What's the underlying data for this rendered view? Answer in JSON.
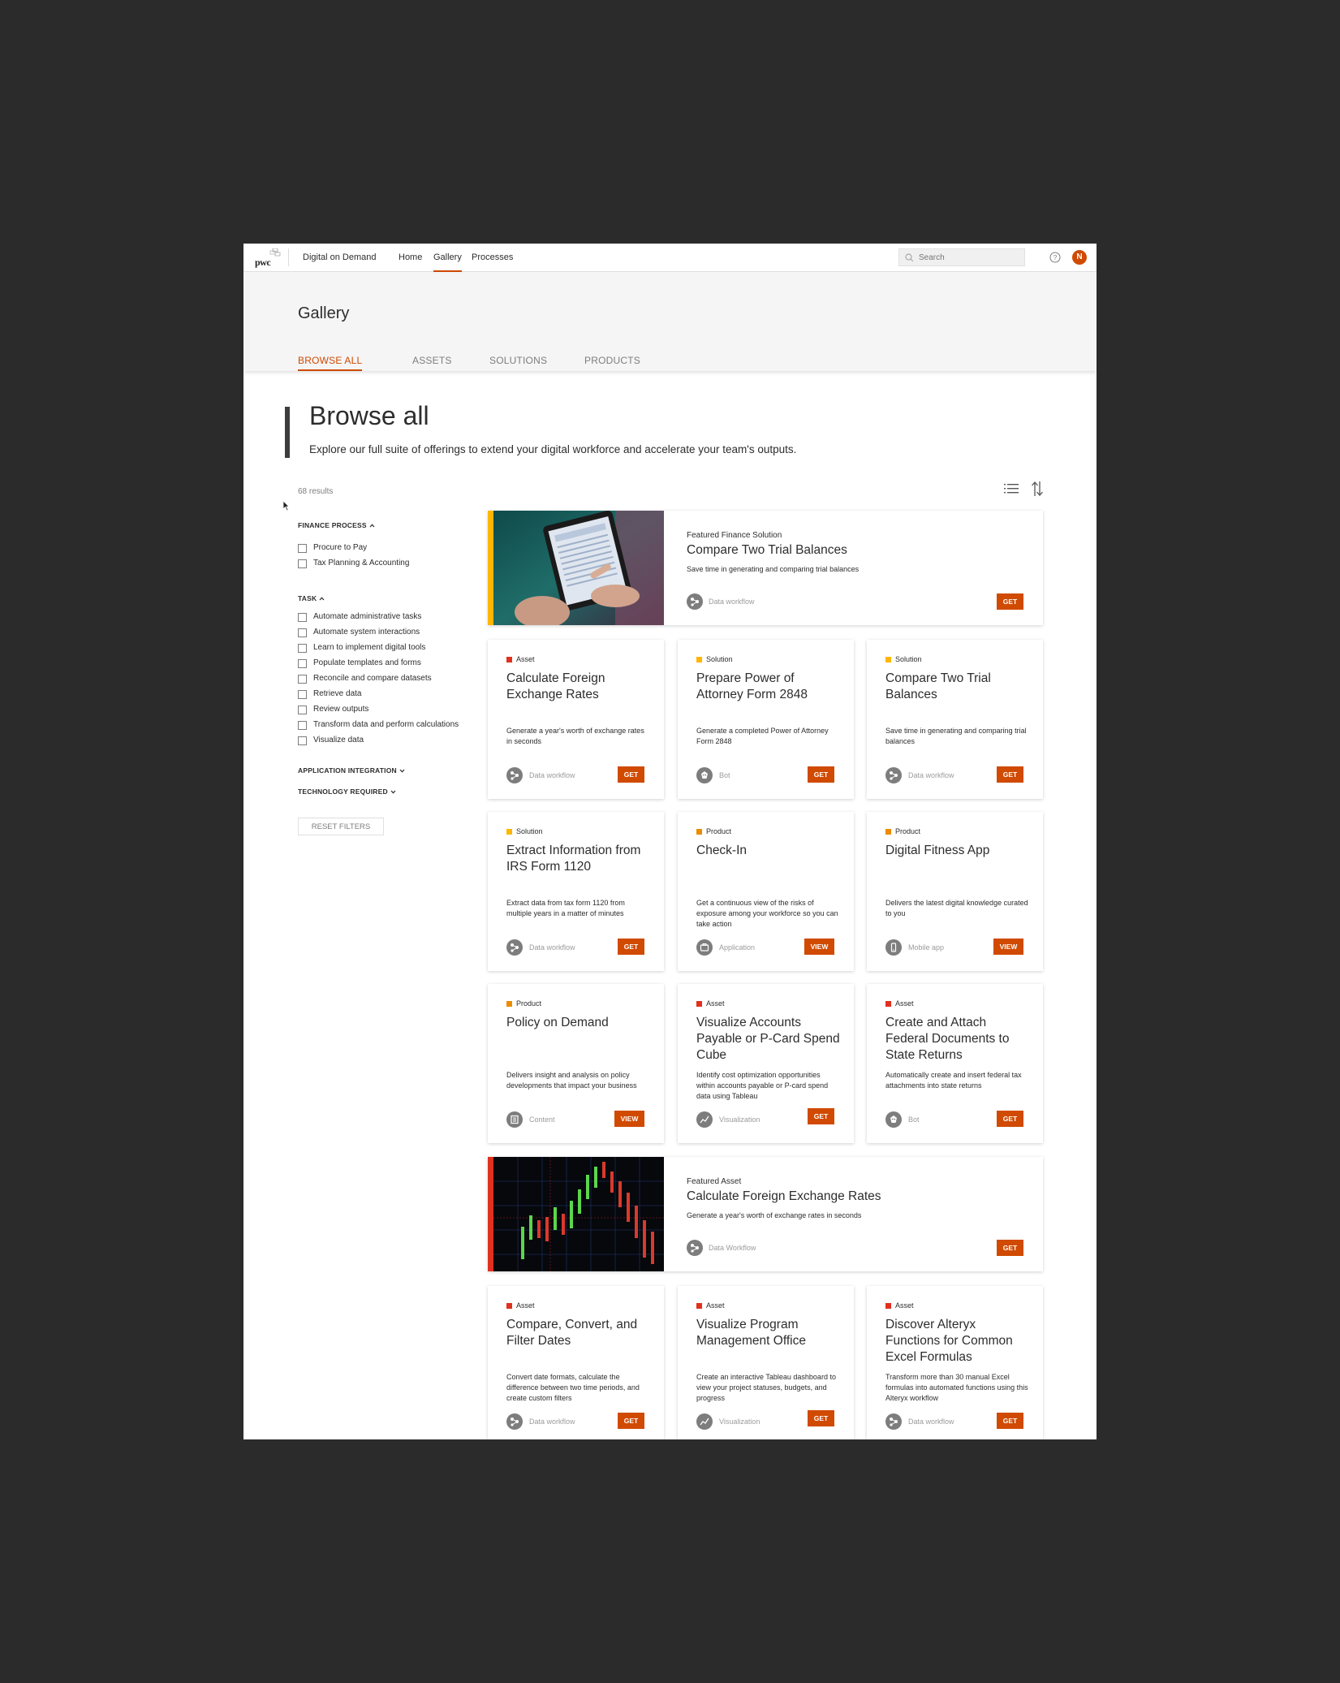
{
  "navbar": {
    "logo_text": "pwc",
    "app_name": "Digital on Demand",
    "links": [
      {
        "label": "Home",
        "active": false
      },
      {
        "label": "Gallery",
        "active": true
      },
      {
        "label": "Processes",
        "active": false
      }
    ],
    "search_placeholder": "Search",
    "avatar_initial": "N"
  },
  "subheader": {
    "title": "Gallery",
    "tabs": [
      {
        "label": "BROWSE ALL",
        "active": true
      },
      {
        "label": "ASSETS",
        "active": false
      },
      {
        "label": "SOLUTIONS",
        "active": false
      },
      {
        "label": "PRODUCTS",
        "active": false
      }
    ]
  },
  "browse": {
    "title": "Browse all",
    "description": "Explore our full suite of offerings to extend your digital workforce and accelerate your team's outputs.",
    "results": "68 results"
  },
  "filters": {
    "finance_process": {
      "heading": "FINANCE PROCESS",
      "expanded": true,
      "options": [
        "Procure to Pay",
        "Tax Planning & Accounting"
      ]
    },
    "task": {
      "heading": "TASK",
      "expanded": true,
      "options": [
        "Automate administrative tasks",
        "Automate system interactions",
        "Learn to implement digital tools",
        "Populate templates and forms",
        "Reconcile and compare datasets",
        "Retrieve data",
        "Review outputs",
        "Transform data and perform calculations",
        "Visualize data"
      ]
    },
    "application_integration": {
      "heading": "APPLICATION INTEGRATION",
      "expanded": false
    },
    "technology_required": {
      "heading": "TECHNOLOGY REQUIRED",
      "expanded": false
    },
    "reset_label": "RESET FILTERS"
  },
  "colors": {
    "accent": "#d04a02",
    "asset": "#e0301e",
    "solution": "#ffb600",
    "product": "#eb8c00"
  },
  "featured": [
    {
      "kicker": "Featured Finance Solution",
      "title": "Compare Two Trial Balances",
      "description": "Save time in generating and comparing trial balances",
      "meta": "Data workflow",
      "meta_icon": "data-workflow-icon",
      "action": "GET",
      "accent": "#ffb600",
      "image": "tablet-hands-image"
    },
    {
      "kicker": "Featured Asset",
      "title": "Calculate Foreign Exchange Rates",
      "description": "Generate a year's worth of exchange rates in seconds",
      "meta": "Data Workflow",
      "meta_icon": "data-workflow-icon",
      "action": "GET",
      "accent": "#e0301e",
      "image": "candlestick-chart-image"
    }
  ],
  "cards": [
    {
      "type": "Asset",
      "color": "#e0301e",
      "title": "Calculate Foreign Exchange Rates",
      "description": "Generate a year's worth of exchange rates in seconds",
      "meta": "Data workflow",
      "meta_icon": "data-workflow-icon",
      "action": "GET"
    },
    {
      "type": "Solution",
      "color": "#ffb600",
      "title": "Prepare Power of Attorney Form 2848",
      "description": "Generate a completed Power of Attorney Form 2848",
      "meta": "Bot",
      "meta_icon": "bot-icon",
      "action": "GET"
    },
    {
      "type": "Solution",
      "color": "#ffb600",
      "title": "Compare Two Trial Balances",
      "description": "Save time in generating and comparing trial balances",
      "meta": "Data workflow",
      "meta_icon": "data-workflow-icon",
      "action": "GET"
    },
    {
      "type": "Solution",
      "color": "#ffb600",
      "title": "Extract Information from IRS Form 1120",
      "description": "Extract data from tax form 1120 from multiple years in a matter of minutes",
      "meta": "Data workflow",
      "meta_icon": "data-workflow-icon",
      "action": "GET"
    },
    {
      "type": "Product",
      "color": "#eb8c00",
      "title": "Check-In",
      "description": "Get a continuous view of the risks of exposure among your workforce so you can take action",
      "meta": "Application",
      "meta_icon": "application-icon",
      "action": "VIEW"
    },
    {
      "type": "Product",
      "color": "#eb8c00",
      "title": "Digital Fitness App",
      "description": "Delivers the latest digital knowledge curated to you",
      "meta": "Mobile app",
      "meta_icon": "mobile-app-icon",
      "action": "VIEW"
    },
    {
      "type": "Product",
      "color": "#eb8c00",
      "title": "Policy on Demand",
      "description": "Delivers insight and analysis on policy developments that impact your business",
      "meta": "Content",
      "meta_icon": "content-icon",
      "action": "VIEW"
    },
    {
      "type": "Asset",
      "color": "#e0301e",
      "title": "Visualize Accounts Payable or P-Card Spend Cube",
      "description": "Identify cost optimization opportunities within accounts payable or P-card spend data using Tableau",
      "meta": "Visualization",
      "meta_icon": "visualization-icon",
      "action": "GET"
    },
    {
      "type": "Asset",
      "color": "#e0301e",
      "title": "Create and Attach Federal Documents to State Returns",
      "description": "Automatically create and insert federal tax attachments into state returns",
      "meta": "Bot",
      "meta_icon": "bot-icon",
      "action": "GET"
    },
    {
      "type": "Asset",
      "color": "#e0301e",
      "title": "Compare, Convert, and Filter Dates",
      "description": "Convert date formats, calculate the difference between two time periods, and create custom filters",
      "meta": "Data workflow",
      "meta_icon": "data-workflow-icon",
      "action": "GET"
    },
    {
      "type": "Asset",
      "color": "#e0301e",
      "title": "Visualize Program Management Office",
      "description": "Create an interactive Tableau dashboard to view your project statuses, budgets, and progress",
      "meta": "Visualization",
      "meta_icon": "visualization-icon",
      "action": "GET"
    },
    {
      "type": "Asset",
      "color": "#e0301e",
      "title": "Discover Alteryx Functions for Common Excel Formulas",
      "description": "Transform more than 30 manual Excel formulas into automated functions using this Alteryx workflow",
      "meta": "Data workflow",
      "meta_icon": "data-workflow-icon",
      "action": "GET"
    }
  ]
}
